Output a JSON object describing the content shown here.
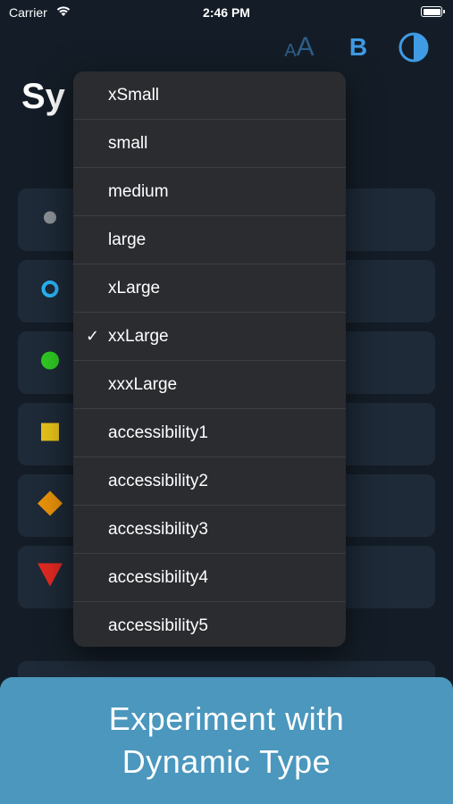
{
  "status_bar": {
    "carrier": "Carrier",
    "time": "2:46 PM"
  },
  "toolbar": {
    "text_size_small": "A",
    "text_size_large": "A",
    "bold_label": "B",
    "colors": {
      "text_size": "#2e5f8c",
      "accent": "#3f9be4"
    }
  },
  "page": {
    "title_fragment": "Sy"
  },
  "cards": [
    {
      "symbol": "gray-circle-icon",
      "color": "#8c9196"
    },
    {
      "symbol": "blue-ring-icon",
      "color": "#2ab4f5"
    },
    {
      "symbol": "green-circle-icon",
      "color": "#2fc823"
    },
    {
      "symbol": "yellow-square-icon",
      "color": "#e6c21a"
    },
    {
      "symbol": "orange-diamond-icon",
      "color": "#e8920a"
    },
    {
      "symbol": "red-triangle-icon",
      "color": "#e02a22"
    }
  ],
  "menu": {
    "selected": "xxLarge",
    "items": [
      "xSmall",
      "small",
      "medium",
      "large",
      "xLarge",
      "xxLarge",
      "xxxLarge",
      "accessibility1",
      "accessibility2",
      "accessibility3",
      "accessibility4",
      "accessibility5"
    ]
  },
  "promo": {
    "line1": "Experiment with",
    "line2": "Dynamic Type",
    "color": "#4b97bd"
  }
}
